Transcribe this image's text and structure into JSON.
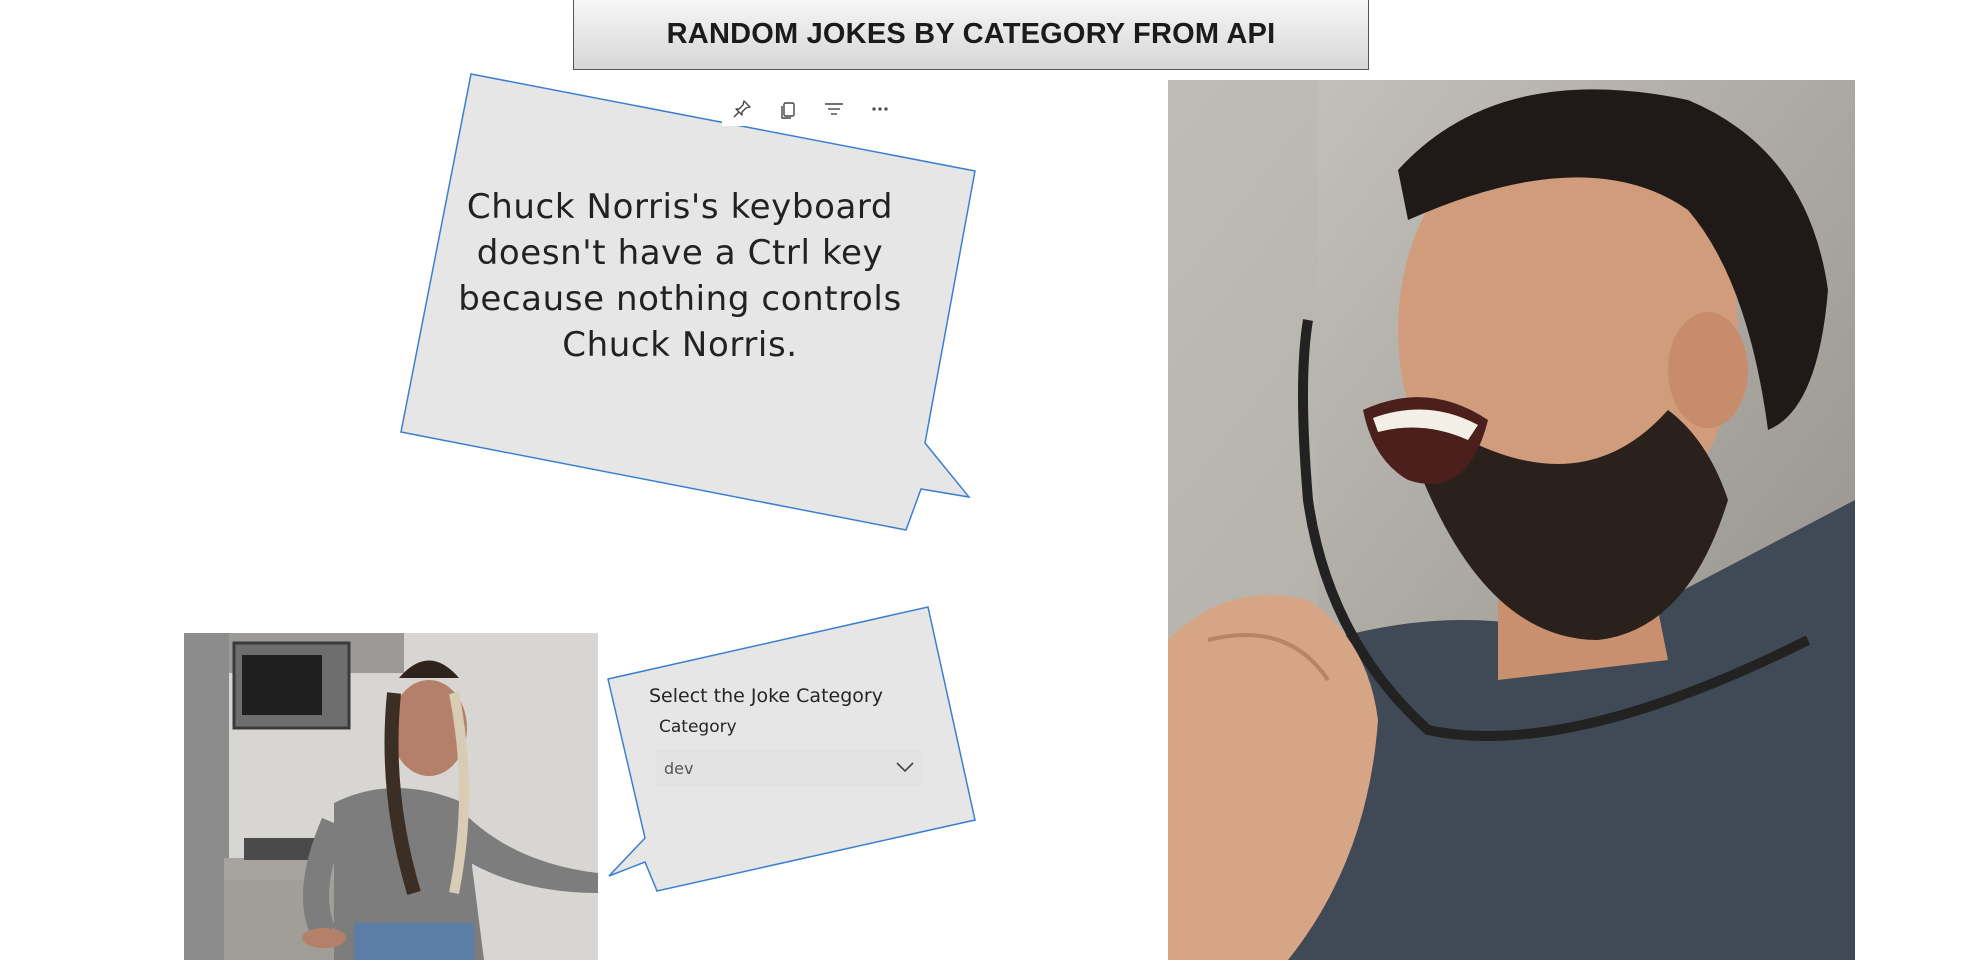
{
  "header": {
    "title": "RANDOM JOKES BY CATEGORY FROM API"
  },
  "joke_card": {
    "text": "Chuck Norris's keyboard doesn't have a Ctrl key because nothing controls Chuck Norris.",
    "toolbar": [
      {
        "icon": "pin-icon"
      },
      {
        "icon": "copy-visual-icon"
      },
      {
        "icon": "filter-icon"
      },
      {
        "icon": "more-options-icon"
      }
    ]
  },
  "slicer": {
    "title": "Select the Joke Category",
    "field_label": "Category",
    "selected_value": "dev"
  },
  "images": {
    "man": "laughing-man-photo",
    "woman": "confused-woman-photo"
  },
  "colors": {
    "bubble_fill": "#e6e6e6",
    "bubble_border": "#3b7fd0",
    "title_border": "#555555"
  }
}
